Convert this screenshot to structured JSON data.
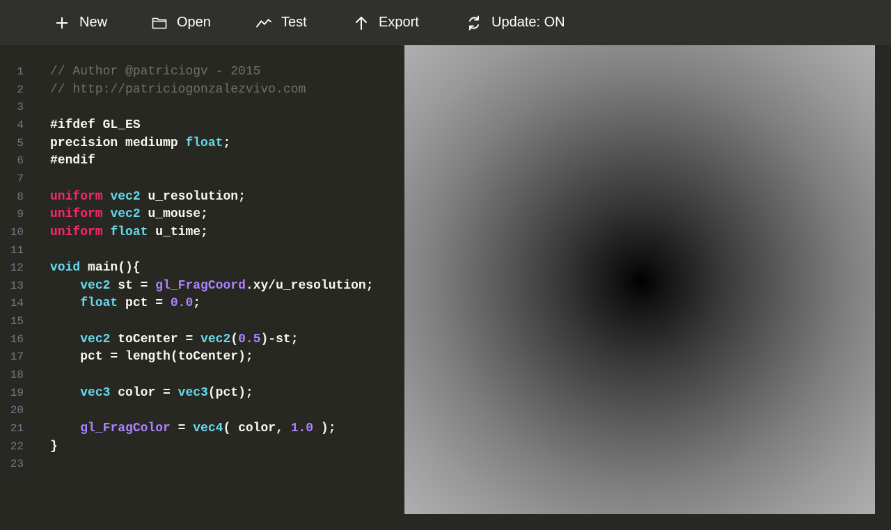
{
  "toolbar": {
    "buttons": [
      {
        "label": "New",
        "icon": "plus-icon"
      },
      {
        "label": "Open",
        "icon": "folder-icon"
      },
      {
        "label": "Test",
        "icon": "line-chart-icon"
      },
      {
        "label": "Export",
        "icon": "arrow-up-icon"
      },
      {
        "label": "Update: ON",
        "icon": "refresh-icon"
      }
    ]
  },
  "colors": {
    "background": "#272822",
    "toolbar": "#30302c",
    "comment": "#75715e",
    "keyword": "#f92672",
    "type": "#66d9ef",
    "number": "#ae81ff",
    "line_number": "#6d7b8a"
  },
  "editor": {
    "lines": [
      [
        {
          "t": "// Author @patriciogv - 2015",
          "c": "comment"
        }
      ],
      [
        {
          "t": "// http://patriciogonzalezvivo.com",
          "c": "comment"
        }
      ],
      [],
      [
        {
          "t": "#ifdef GL_ES",
          "c": "plain"
        }
      ],
      [
        {
          "t": "precision mediump ",
          "c": "plain"
        },
        {
          "t": "float",
          "c": "type"
        },
        {
          "t": ";",
          "c": "plain"
        }
      ],
      [
        {
          "t": "#endif",
          "c": "plain"
        }
      ],
      [],
      [
        {
          "t": "uniform",
          "c": "keyword"
        },
        {
          "t": " ",
          "c": "plain"
        },
        {
          "t": "vec2",
          "c": "type"
        },
        {
          "t": " u_resolution;",
          "c": "plain"
        }
      ],
      [
        {
          "t": "uniform",
          "c": "keyword"
        },
        {
          "t": " ",
          "c": "plain"
        },
        {
          "t": "vec2",
          "c": "type"
        },
        {
          "t": " u_mouse;",
          "c": "plain"
        }
      ],
      [
        {
          "t": "uniform",
          "c": "keyword"
        },
        {
          "t": " ",
          "c": "plain"
        },
        {
          "t": "float",
          "c": "type"
        },
        {
          "t": " u_time;",
          "c": "plain"
        }
      ],
      [],
      [
        {
          "t": "void",
          "c": "type"
        },
        {
          "t": " main(){",
          "c": "plain"
        }
      ],
      [
        {
          "t": "    ",
          "c": "plain"
        },
        {
          "t": "vec2",
          "c": "type"
        },
        {
          "t": " st = ",
          "c": "plain"
        },
        {
          "t": "gl_FragCoord",
          "c": "builtin"
        },
        {
          "t": ".xy/u_resolution;",
          "c": "plain"
        }
      ],
      [
        {
          "t": "    ",
          "c": "plain"
        },
        {
          "t": "float",
          "c": "type"
        },
        {
          "t": " pct = ",
          "c": "plain"
        },
        {
          "t": "0.0",
          "c": "number"
        },
        {
          "t": ";",
          "c": "plain"
        }
      ],
      [],
      [
        {
          "t": "    ",
          "c": "plain"
        },
        {
          "t": "vec2",
          "c": "type"
        },
        {
          "t": " toCenter = ",
          "c": "plain"
        },
        {
          "t": "vec2",
          "c": "type"
        },
        {
          "t": "(",
          "c": "plain"
        },
        {
          "t": "0.5",
          "c": "number"
        },
        {
          "t": ")-st;",
          "c": "plain"
        }
      ],
      [
        {
          "t": "    pct = length(toCenter);",
          "c": "plain"
        }
      ],
      [],
      [
        {
          "t": "    ",
          "c": "plain"
        },
        {
          "t": "vec3",
          "c": "type"
        },
        {
          "t": " color = ",
          "c": "plain"
        },
        {
          "t": "vec3",
          "c": "type"
        },
        {
          "t": "(pct);",
          "c": "plain"
        }
      ],
      [],
      [
        {
          "t": "    ",
          "c": "plain"
        },
        {
          "t": "gl_FragColor",
          "c": "builtin"
        },
        {
          "t": " = ",
          "c": "plain"
        },
        {
          "t": "vec4",
          "c": "type"
        },
        {
          "t": "( color, ",
          "c": "plain"
        },
        {
          "t": "1.0",
          "c": "number"
        },
        {
          "t": " );",
          "c": "plain"
        }
      ],
      [
        {
          "t": "}",
          "c": "plain"
        }
      ],
      []
    ]
  }
}
